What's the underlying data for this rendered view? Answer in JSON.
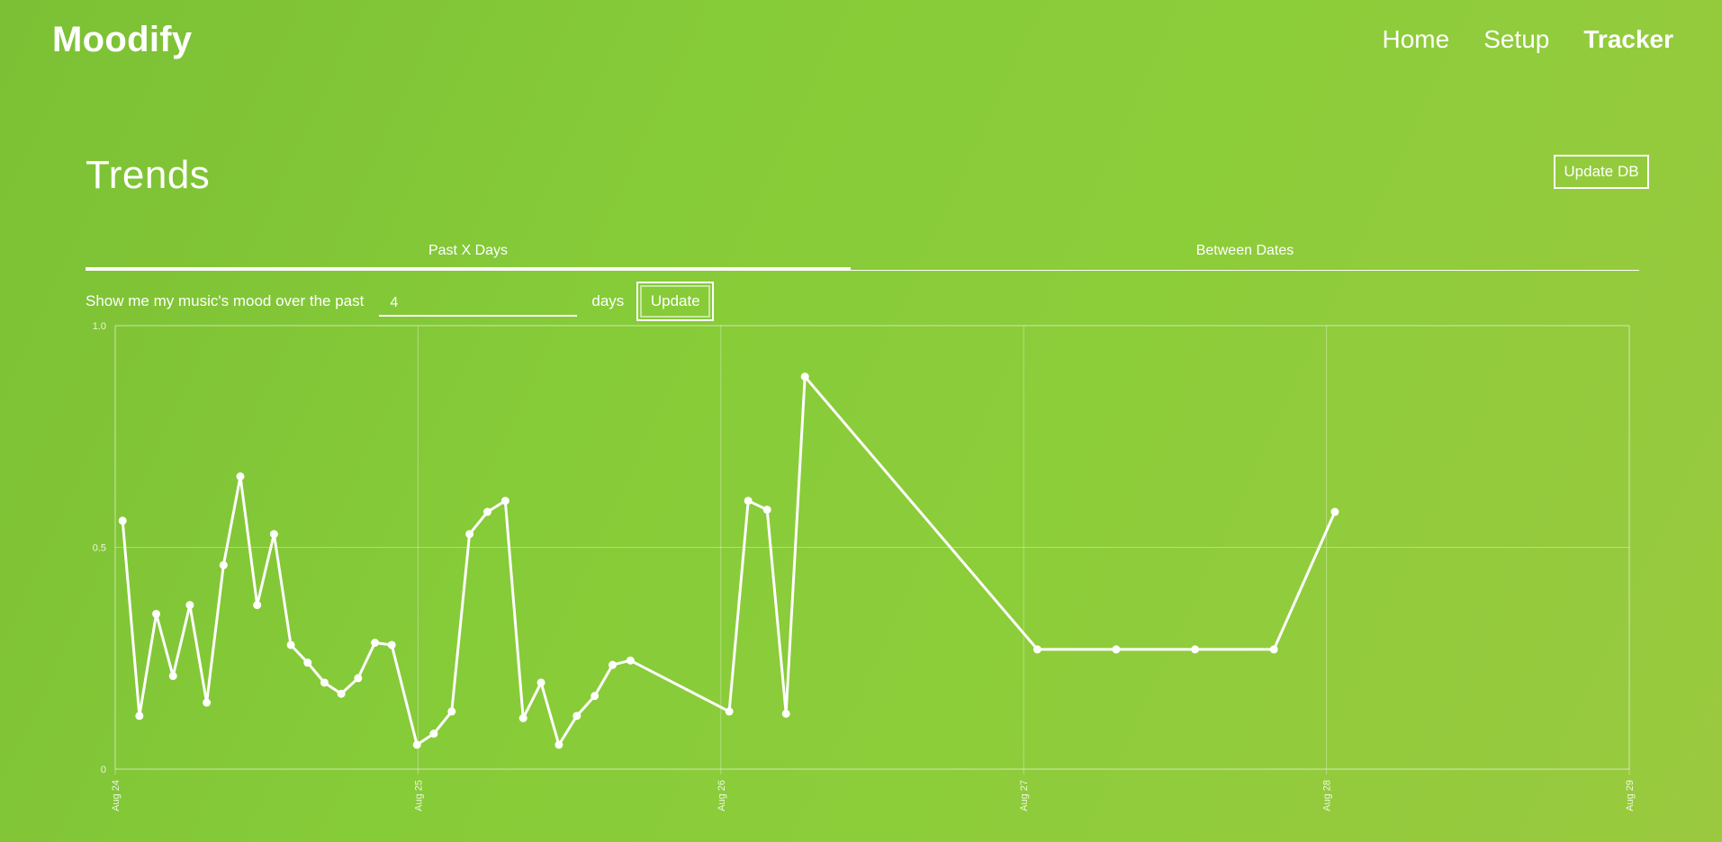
{
  "app": {
    "brand": "Moodify",
    "nav": [
      {
        "label": "Home",
        "active": false
      },
      {
        "label": "Setup",
        "active": false
      },
      {
        "label": "Tracker",
        "active": true
      }
    ]
  },
  "page": {
    "title": "Trends",
    "update_db_label": "Update DB"
  },
  "tabs": [
    {
      "label": "Past X Days",
      "active": true
    },
    {
      "label": "Between Dates",
      "active": false
    }
  ],
  "filter": {
    "prefix": "Show me my music's mood over the past",
    "days_value": "4",
    "suffix": "days",
    "update_label": "Update"
  },
  "colors": {
    "accent": "#ffffff",
    "background_start": "#7cc035",
    "background_end": "#9ac93f"
  },
  "chart_data": {
    "type": "line",
    "title": "",
    "xlabel": "",
    "ylabel": "",
    "ylim": [
      0,
      1.0
    ],
    "xlim": [
      "2021-08-24T00:00",
      "2021-08-29T00:00"
    ],
    "y_ticks": [
      {
        "value": 0,
        "label": "0"
      },
      {
        "value": 0.5,
        "label": "0.5"
      },
      {
        "value": 1.0,
        "label": "1.0"
      }
    ],
    "x_ticks": [
      {
        "t": "2021-08-24T00:00",
        "label": "Aug 24"
      },
      {
        "t": "2021-08-25T00:00",
        "label": "Aug 25"
      },
      {
        "t": "2021-08-26T00:00",
        "label": "Aug 26"
      },
      {
        "t": "2021-08-27T00:00",
        "label": "Aug 27"
      },
      {
        "t": "2021-08-28T00:00",
        "label": "Aug 28"
      },
      {
        "t": "2021-08-29T00:00",
        "label": "Aug 29"
      }
    ],
    "grid": true,
    "series": [
      {
        "color": "#ffffff",
        "points": [
          {
            "t": "2021-08-24T00:35",
            "y": 0.56
          },
          {
            "t": "2021-08-24T01:55",
            "y": 0.12
          },
          {
            "t": "2021-08-24T03:15",
            "y": 0.35
          },
          {
            "t": "2021-08-24T04:35",
            "y": 0.21
          },
          {
            "t": "2021-08-24T05:55",
            "y": 0.37
          },
          {
            "t": "2021-08-24T07:15",
            "y": 0.15
          },
          {
            "t": "2021-08-24T08:35",
            "y": 0.46
          },
          {
            "t": "2021-08-24T09:55",
            "y": 0.66
          },
          {
            "t": "2021-08-24T11:15",
            "y": 0.37
          },
          {
            "t": "2021-08-24T12:35",
            "y": 0.53
          },
          {
            "t": "2021-08-24T13:55",
            "y": 0.28
          },
          {
            "t": "2021-08-24T15:15",
            "y": 0.24
          },
          {
            "t": "2021-08-24T16:35",
            "y": 0.195
          },
          {
            "t": "2021-08-24T17:55",
            "y": 0.17
          },
          {
            "t": "2021-08-24T19:15",
            "y": 0.205
          },
          {
            "t": "2021-08-24T20:35",
            "y": 0.285
          },
          {
            "t": "2021-08-24T21:55",
            "y": 0.28
          },
          {
            "t": "2021-08-24T23:55",
            "y": 0.055
          },
          {
            "t": "2021-08-25T01:15",
            "y": 0.08
          },
          {
            "t": "2021-08-25T02:40",
            "y": 0.13
          },
          {
            "t": "2021-08-25T04:05",
            "y": 0.53
          },
          {
            "t": "2021-08-25T05:30",
            "y": 0.58
          },
          {
            "t": "2021-08-25T06:55",
            "y": 0.605
          },
          {
            "t": "2021-08-25T08:20",
            "y": 0.115
          },
          {
            "t": "2021-08-25T09:45",
            "y": 0.195
          },
          {
            "t": "2021-08-25T11:10",
            "y": 0.055
          },
          {
            "t": "2021-08-25T12:35",
            "y": 0.12
          },
          {
            "t": "2021-08-25T14:00",
            "y": 0.165
          },
          {
            "t": "2021-08-25T15:25",
            "y": 0.235
          },
          {
            "t": "2021-08-25T16:50",
            "y": 0.245
          },
          {
            "t": "2021-08-26T00:40",
            "y": 0.13
          },
          {
            "t": "2021-08-26T02:10",
            "y": 0.605
          },
          {
            "t": "2021-08-26T03:40",
            "y": 0.585
          },
          {
            "t": "2021-08-26T05:10",
            "y": 0.125
          },
          {
            "t": "2021-08-26T06:40",
            "y": 0.885
          },
          {
            "t": "2021-08-27T01:05",
            "y": 0.27
          },
          {
            "t": "2021-08-27T07:20",
            "y": 0.27
          },
          {
            "t": "2021-08-27T13:35",
            "y": 0.27
          },
          {
            "t": "2021-08-27T19:50",
            "y": 0.27
          },
          {
            "t": "2021-08-28T00:40",
            "y": 0.58
          }
        ]
      }
    ]
  }
}
